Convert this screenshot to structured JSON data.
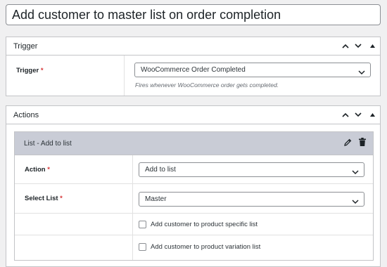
{
  "workflow_title": "Add customer to master list on order completion",
  "trigger_box": {
    "title": "Trigger",
    "field_label": "Trigger",
    "required_mark": "*",
    "selected_value": "WooCommerce Order Completed",
    "description": "Fires whenever WooCommerce order gets completed."
  },
  "actions_box": {
    "title": "Actions",
    "action": {
      "header_title": "List - Add to list",
      "action_label": "Action",
      "action_value": "Add to list",
      "list_label": "Select List",
      "list_value": "Master",
      "required_mark": "*",
      "checkbox1_label": "Add customer to product specific list",
      "checkbox2_label": "Add customer to product variation list"
    }
  },
  "icons": [
    "chevron-up-icon",
    "chevron-down-icon",
    "arrow-up-icon",
    "pencil-icon",
    "trash-icon"
  ]
}
